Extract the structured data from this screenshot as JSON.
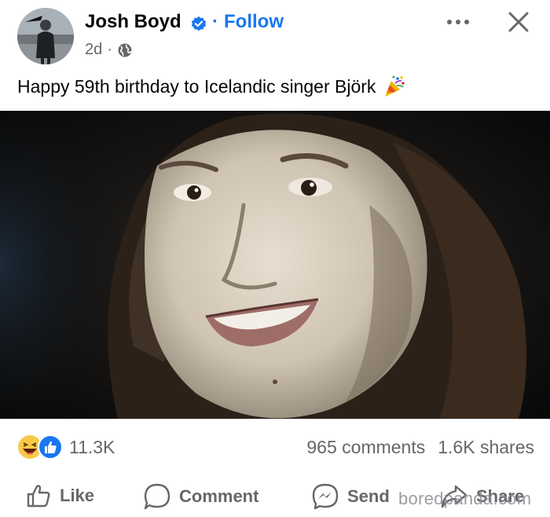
{
  "post": {
    "author": "Josh Boyd",
    "follow_label": "Follow",
    "separator": "·",
    "time": "2d",
    "time_separator": "·",
    "audience_icon": "globe-icon",
    "caption": "Happy 59th birthday to Icelandic singer Björk",
    "caption_emoji": "party-popper-icon"
  },
  "stats": {
    "reaction_icons": [
      "laugh-reaction-icon",
      "like-reaction-icon"
    ],
    "reaction_count": "11.3K",
    "comments": "965 comments",
    "shares": "1.6K shares"
  },
  "actions": {
    "like_label": "Like",
    "comment_label": "Comment",
    "send_label": "Send",
    "share_label": "Share"
  },
  "watermark": "boredpanda.com",
  "colors": {
    "accent": "#1877f2",
    "secondary_text": "#65676b",
    "primary_text": "#050505"
  }
}
